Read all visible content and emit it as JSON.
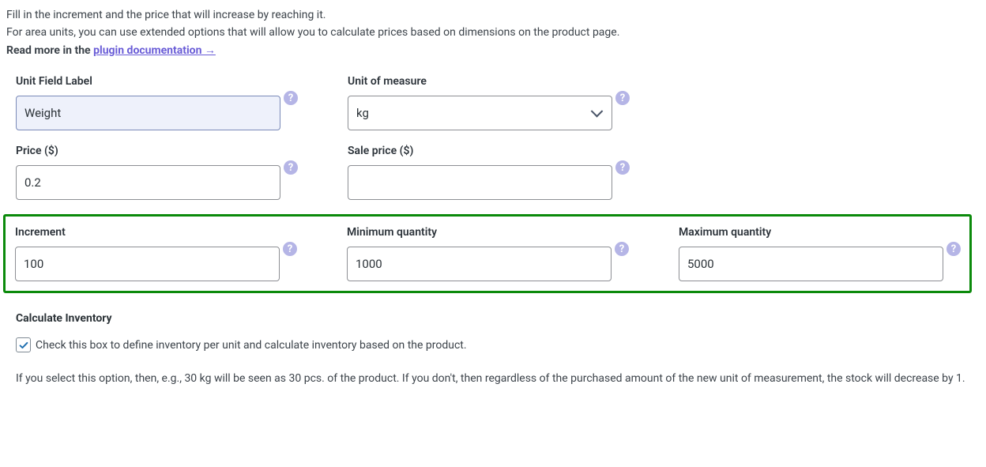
{
  "intro": {
    "line1": "Fill in the increment and the price that will increase by reaching it.",
    "line2": "For area units, you can use extended options that will allow you to calculate prices based on dimensions on the product page.",
    "readmore_prefix": "Read more in the ",
    "link_text": "plugin documentation →"
  },
  "fields": {
    "unit_field_label": {
      "label": "Unit Field Label",
      "value": "Weight"
    },
    "unit_of_measure": {
      "label": "Unit of measure",
      "value": "kg"
    },
    "price": {
      "label": "Price ($)",
      "value": "0.2"
    },
    "sale_price": {
      "label": "Sale price ($)",
      "value": ""
    },
    "increment": {
      "label": "Increment",
      "value": "100"
    },
    "min_qty": {
      "label": "Minimum quantity",
      "value": "1000"
    },
    "max_qty": {
      "label": "Maximum quantity",
      "value": "5000"
    }
  },
  "inventory": {
    "title": "Calculate Inventory",
    "checkbox_label": "Check this box to define inventory per unit and calculate inventory based on the product.",
    "note": "If you select this option, then, e.g., 30 kg will be seen as 30 pcs. of the product. If you don't, then regardless of the purchased amount of the new unit of measurement, the stock will decrease by 1."
  },
  "help_glyph": "?"
}
